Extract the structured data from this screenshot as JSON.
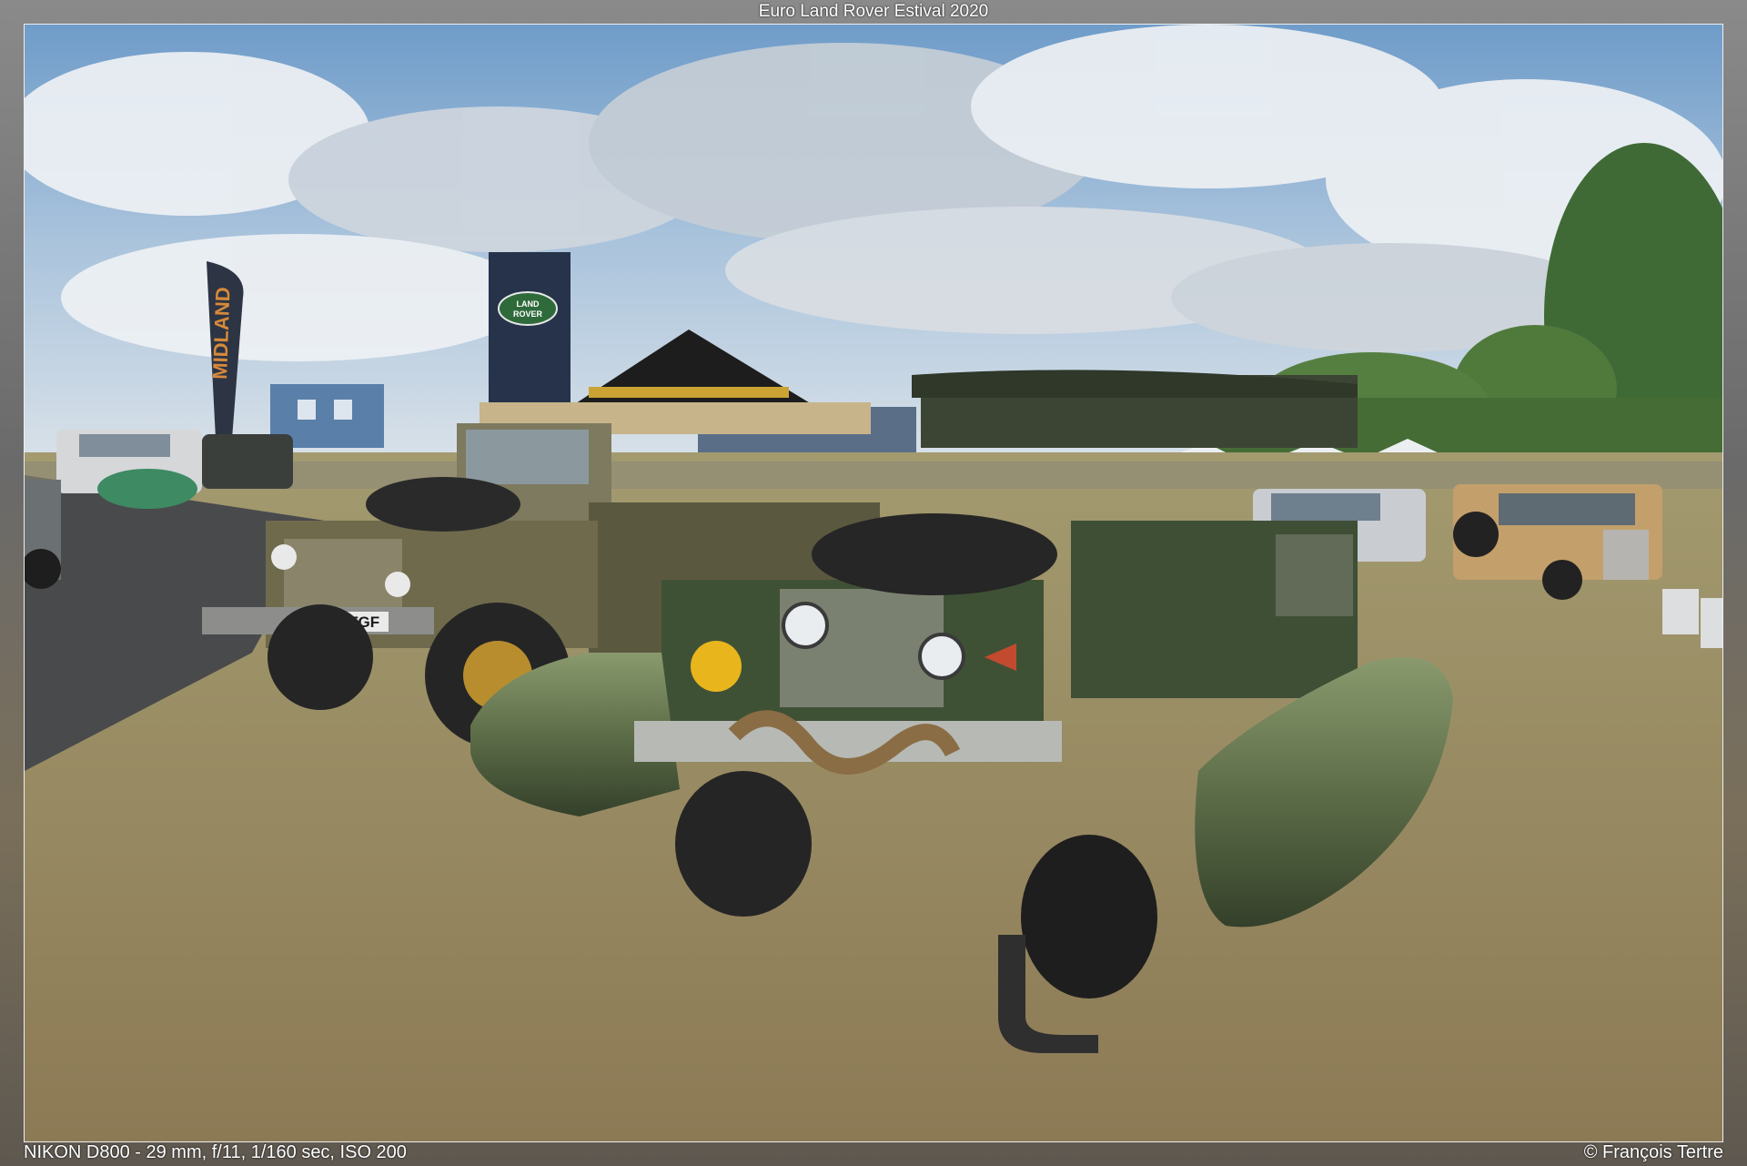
{
  "page": {
    "title": "Euro Land Rover Estival 2020",
    "exif": "NIKON D800 - 29 mm, f/11, 1/160 sec, ISO 200",
    "copyright": "© François Tertre"
  },
  "photo": {
    "signs": {
      "flag_left": "MIDLAND",
      "banner_badge_line1": "LAND",
      "banner_badge_line2": "ROVER",
      "front_plate": "G274 TGF"
    }
  }
}
